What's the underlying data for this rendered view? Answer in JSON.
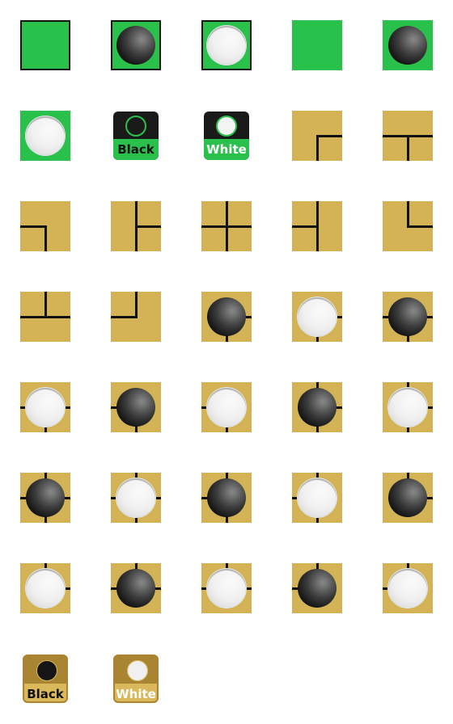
{
  "colors": {
    "green": "#2ac04c",
    "board": "#d4b356",
    "badge_gold": "#a88433",
    "badge_dark": "#1a1a1a"
  },
  "labels": {
    "black": "Black",
    "white": "White"
  },
  "tiles": [
    {
      "kind": "green",
      "border": true,
      "stone": null
    },
    {
      "kind": "green",
      "border": true,
      "stone": "black"
    },
    {
      "kind": "green",
      "border": true,
      "stone": "white"
    },
    {
      "kind": "green",
      "border": false,
      "stone": null
    },
    {
      "kind": "green",
      "border": false,
      "stone": "black"
    },
    {
      "kind": "green",
      "border": false,
      "stone": "white"
    },
    {
      "kind": "badge-green",
      "stone": "black",
      "label": "black"
    },
    {
      "kind": "badge-green",
      "stone": "white",
      "label": "white"
    },
    {
      "kind": "board",
      "lines": "dr",
      "stone": null
    },
    {
      "kind": "board",
      "lines": "lrd",
      "stone": null
    },
    {
      "kind": "board",
      "lines": "ld",
      "stone": null
    },
    {
      "kind": "board",
      "lines": "udr",
      "stone": null
    },
    {
      "kind": "board",
      "lines": "udlr",
      "stone": null
    },
    {
      "kind": "board",
      "lines": "udl",
      "stone": null
    },
    {
      "kind": "board",
      "lines": "ur",
      "stone": null
    },
    {
      "kind": "board",
      "lines": "lru",
      "stone": null
    },
    {
      "kind": "board",
      "lines": "ul",
      "stone": null
    },
    {
      "kind": "board",
      "lines": "dr",
      "stone": "black"
    },
    {
      "kind": "board",
      "lines": "dr",
      "stone": "white"
    },
    {
      "kind": "board",
      "lines": "lrd",
      "stone": "black"
    },
    {
      "kind": "board",
      "lines": "lrd",
      "stone": "white"
    },
    {
      "kind": "board",
      "lines": "ld",
      "stone": "black"
    },
    {
      "kind": "board",
      "lines": "ld",
      "stone": "white"
    },
    {
      "kind": "board",
      "lines": "udr",
      "stone": "black"
    },
    {
      "kind": "board",
      "lines": "udr",
      "stone": "white"
    },
    {
      "kind": "board",
      "lines": "udlr",
      "stone": "black"
    },
    {
      "kind": "board",
      "lines": "udlr",
      "stone": "white"
    },
    {
      "kind": "board",
      "lines": "udl",
      "stone": "black"
    },
    {
      "kind": "board",
      "lines": "udl",
      "stone": "white"
    },
    {
      "kind": "board",
      "lines": "ur",
      "stone": "black"
    },
    {
      "kind": "board",
      "lines": "ur",
      "stone": "white"
    },
    {
      "kind": "board",
      "lines": "lru",
      "stone": "black"
    },
    {
      "kind": "board",
      "lines": "lru",
      "stone": "white"
    },
    {
      "kind": "board",
      "lines": "ul",
      "stone": "black"
    },
    {
      "kind": "board",
      "lines": "ul",
      "stone": "white"
    },
    {
      "kind": "badge-gold",
      "stone": "black",
      "label": "black"
    },
    {
      "kind": "badge-gold",
      "stone": "white",
      "label": "white"
    }
  ]
}
